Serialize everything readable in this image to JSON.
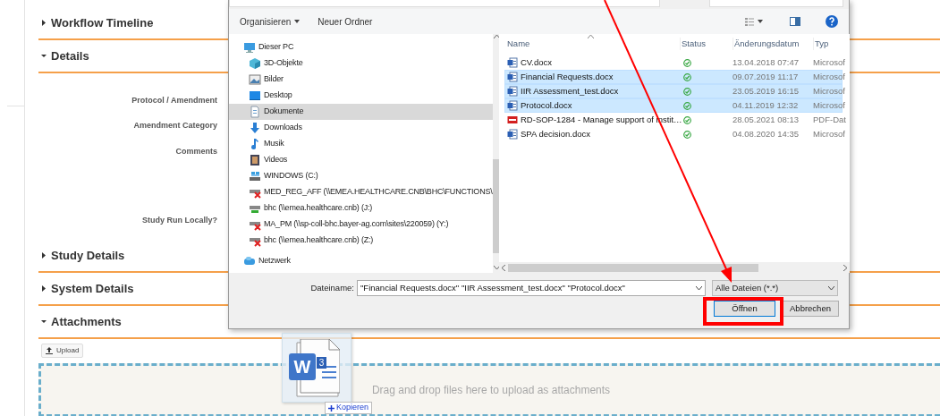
{
  "page": {
    "sections": [
      {
        "title": "Workflow Timeline",
        "expanded": false
      },
      {
        "title": "Details",
        "expanded": true,
        "fields": [
          {
            "label": "Protocol / Amendment",
            "kind": "text"
          },
          {
            "label": "Amendment Category",
            "kind": "text"
          },
          {
            "label": "Comments",
            "kind": "textarea"
          },
          {
            "label": "Study Run Locally?",
            "kind": "text"
          }
        ]
      },
      {
        "title": "Study Details",
        "expanded": false
      },
      {
        "title": "System Details",
        "expanded": false
      },
      {
        "title": "Attachments",
        "expanded": true,
        "upload_button": "Upload",
        "dropzone_text": "Drag and drop files here to upload as attachments"
      }
    ]
  },
  "dialog": {
    "toolbar": [
      {
        "label": "Organisieren",
        "kind": "menu"
      },
      {
        "label": "Neuer Ordner",
        "kind": "button"
      }
    ],
    "nav": [
      {
        "label": "Dieser PC",
        "kind": "pc",
        "selected": false,
        "children": [
          {
            "label": "3D-Objekte",
            "kind": "objects3d",
            "selected": false
          },
          {
            "label": "Bilder",
            "kind": "pictures",
            "selected": false
          },
          {
            "label": "Desktop",
            "kind": "desktop",
            "selected": false
          },
          {
            "label": "Dokumente",
            "kind": "documents",
            "selected": true
          },
          {
            "label": "Downloads",
            "kind": "downloads",
            "selected": false
          },
          {
            "label": "Musik",
            "kind": "music",
            "selected": false
          },
          {
            "label": "Videos",
            "kind": "videos",
            "selected": false
          },
          {
            "label": "WINDOWS (C:)",
            "kind": "drive",
            "selected": false
          },
          {
            "label": "MED_REG_AFF (\\\\EMEA.HEALTHCARE.CNB\\BHC\\FUNCTIONS\\",
            "kind": "network-drive",
            "connected": false,
            "selected": false
          },
          {
            "label": "bhc (\\\\emea.healthcare.cnb) (J:)",
            "kind": "network-drive",
            "connected": true,
            "selected": false
          },
          {
            "label": "MA_PM (\\\\sp-coll-bhc.bayer-ag.com\\sites\\220059) (Y:)",
            "kind": "network-drive",
            "connected": false,
            "selected": false
          },
          {
            "label": "bhc (\\\\emea.healthcare.cnb) (Z:)",
            "kind": "network-drive",
            "connected": false,
            "selected": false
          }
        ]
      },
      {
        "label": "Netzwerk",
        "kind": "network",
        "selected": false
      }
    ],
    "columns": [
      "Name",
      "Status",
      "Änderungsdatum",
      "Typ"
    ],
    "files": [
      {
        "name": "CV.docx",
        "kind": "word",
        "date": "13.04.2018 07:47",
        "type": "Microsof",
        "selected": false
      },
      {
        "name": "Financial Requests.docx",
        "kind": "word",
        "date": "09.07.2019 11:17",
        "type": "Microsof",
        "selected": true
      },
      {
        "name": "IIR Assessment_test.docx",
        "kind": "word",
        "date": "23.05.2019 16:15",
        "type": "Microsof",
        "selected": true
      },
      {
        "name": "Protocol.docx",
        "kind": "word",
        "date": "04.11.2019 12:32",
        "type": "Microsof",
        "selected": true
      },
      {
        "name": "RD-SOP-1284 - Manage support of instit…",
        "kind": "pdf",
        "date": "28.05.2021 08:13",
        "type": "PDF-Dat",
        "selected": false
      },
      {
        "name": "SPA decision.docx",
        "kind": "word",
        "date": "04.08.2020 14:35",
        "type": "Microsof",
        "selected": false
      }
    ],
    "filename_label": "Dateiname:",
    "filename": "\"Financial Requests.docx\" \"IIR Assessment_test.docx\" \"Protocol.docx\"",
    "filter": "Alle Dateien (*.*)",
    "buttons": [
      {
        "label": "Öffnen",
        "default": true
      },
      {
        "label": "Abbrechen",
        "default": false
      }
    ]
  },
  "drag_ghost": {
    "app_letter": "W",
    "count": "3",
    "action": "Kopieren"
  }
}
